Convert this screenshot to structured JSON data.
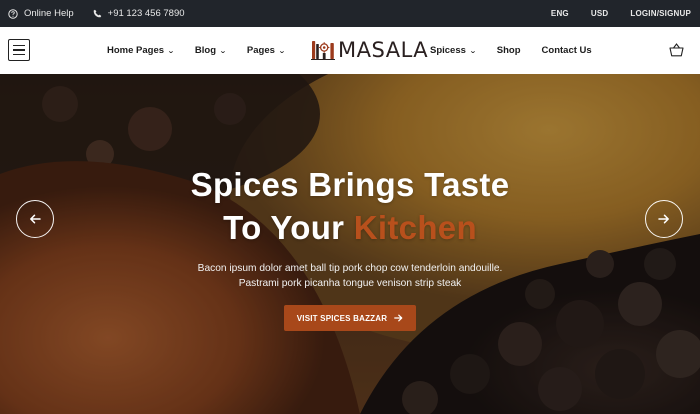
{
  "topbar": {
    "help_icon": "question-circle-icon",
    "help_label": "Online Help",
    "phone_icon": "phone-icon",
    "phone_number": "+91 123 456 7890",
    "language": "ENG",
    "currency": "USD",
    "auth_link": "LOGIN/SIGNUP"
  },
  "nav": {
    "menu_icon": "hamburger-menu-icon",
    "left_items": [
      {
        "label": "Home Pages",
        "has_dropdown": true
      },
      {
        "label": "Blog",
        "has_dropdown": true
      },
      {
        "label": "Pages",
        "has_dropdown": true
      }
    ],
    "logo_text": "MASALA",
    "right_items": [
      {
        "label": "Spicess",
        "has_dropdown": true
      },
      {
        "label": "Shop",
        "has_dropdown": false
      },
      {
        "label": "Contact Us",
        "has_dropdown": false
      }
    ],
    "cart_icon": "shopping-basket-icon",
    "chevron": "⌄"
  },
  "hero": {
    "headline_line1": "Spices Brings Taste",
    "headline_line2_prefix": "To Your ",
    "headline_line2_accent": "Kitchen",
    "subtext_line1": "Bacon ipsum dolor amet ball tip pork chop cow tenderloin andouille.",
    "subtext_line2": "Pastrami pork picanha tongue venison strip steak",
    "cta_label": "VISIT SPICES BAZZAR",
    "prev_icon": "arrow-left-icon",
    "next_icon": "arrow-right-icon"
  },
  "colors": {
    "topbar_bg": "#21252b",
    "accent": "#b8501c",
    "button_bg": "#a8481a",
    "nav_text": "#1c1c1c"
  }
}
